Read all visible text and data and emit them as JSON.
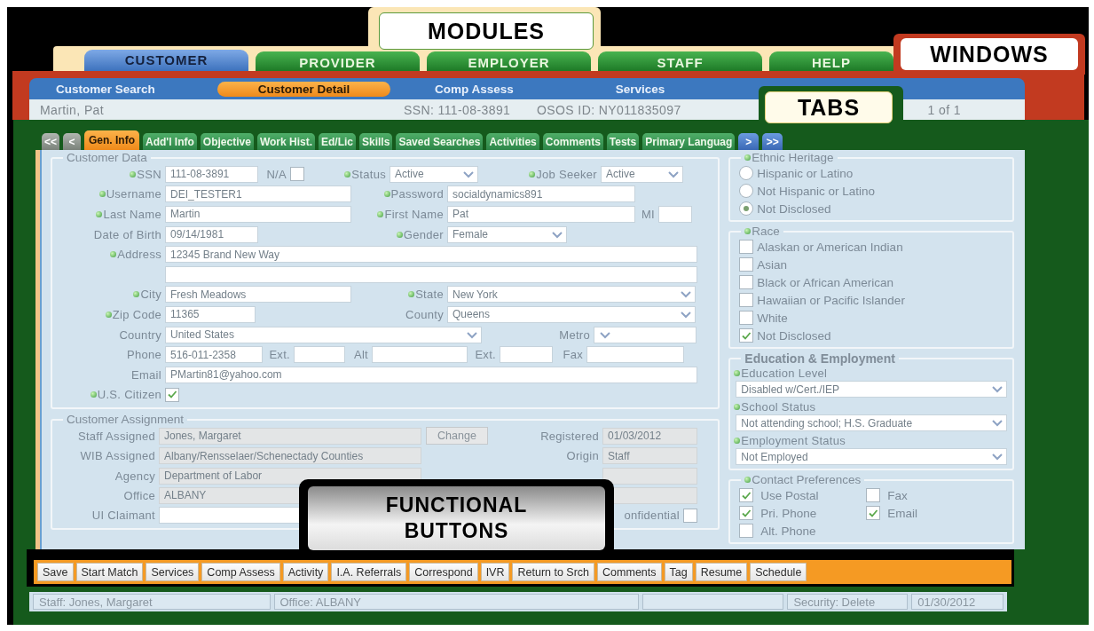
{
  "callouts": [
    "MODULES",
    "WINDOWS",
    "TABS",
    "FUNCTIONAL BUTTONS"
  ],
  "modules": [
    {
      "label": "CUSTOMER",
      "selected": true
    },
    {
      "label": "PROVIDER",
      "selected": false
    },
    {
      "label": "EMPLOYER",
      "selected": false
    },
    {
      "label": "STAFF",
      "selected": false
    },
    {
      "label": "HELP",
      "selected": false
    }
  ],
  "window": {
    "nav": [
      {
        "label": "Customer Search",
        "selected": false
      },
      {
        "label": "Customer Detail",
        "selected": true
      },
      {
        "label": "Comp Assess",
        "selected": false
      },
      {
        "label": "Services",
        "selected": false
      }
    ],
    "customer_name": "Martin, Pat",
    "ssn": "SSN: 111-08-3891",
    "osos_id": "OSOS ID: NY011835097",
    "record_count": "1 of 1"
  },
  "tab_scroll": [
    "<<",
    "<",
    ">",
    ">>"
  ],
  "tabs": [
    {
      "label": "Gen. Info",
      "selected": true
    },
    {
      "label": "Add'l Info",
      "selected": false
    },
    {
      "label": "Objective",
      "selected": false
    },
    {
      "label": "Work Hist.",
      "selected": false
    },
    {
      "label": "Ed/Lic",
      "selected": false
    },
    {
      "label": "Skills",
      "selected": false
    },
    {
      "label": "Saved Searches",
      "selected": false
    },
    {
      "label": "Activities",
      "selected": false
    },
    {
      "label": "Comments",
      "selected": false
    },
    {
      "label": "Tests",
      "selected": false
    },
    {
      "label": "Primary Languag",
      "selected": false
    }
  ],
  "customer_data": {
    "title": "Customer Data",
    "rows": [
      {
        "fields": [
          {
            "label": "SSN",
            "required": true,
            "kind": "text",
            "value": "111-08-3891"
          },
          {
            "label": "N/A",
            "kind": "checkbox",
            "checked": false
          },
          {
            "label": "Status",
            "required": true,
            "kind": "select",
            "value": "Active"
          },
          {
            "label": "Job Seeker",
            "required": true,
            "kind": "select",
            "value": "Active"
          }
        ]
      },
      {
        "fields": [
          {
            "label": "Username",
            "required": true,
            "kind": "text",
            "value": "DEI_TESTER1"
          },
          {
            "label": "Password",
            "required": true,
            "kind": "text",
            "value": "socialdynamics891"
          }
        ]
      },
      {
        "fields": [
          {
            "label": "Last Name",
            "required": true,
            "kind": "text",
            "value": "Martin"
          },
          {
            "label": "First Name",
            "required": true,
            "kind": "text",
            "value": "Pat"
          },
          {
            "label": "MI",
            "kind": "text"
          }
        ]
      },
      {
        "fields": [
          {
            "label": "Date of Birth",
            "kind": "text",
            "value": "09/14/1981"
          },
          {
            "label": "Gender",
            "required": true,
            "kind": "select",
            "value": "Female"
          }
        ]
      },
      {
        "fields": [
          {
            "label": "Address",
            "required": true,
            "kind": "text",
            "value": "12345 Brand New Way"
          }
        ]
      },
      {
        "fields": [
          {
            "kind": "text"
          }
        ]
      },
      {
        "fields": [
          {
            "label": "City",
            "required": true,
            "kind": "text",
            "value": "Fresh Meadows"
          },
          {
            "label": "State",
            "required": true,
            "kind": "select",
            "value": "New York"
          }
        ]
      },
      {
        "fields": [
          {
            "label": "Zip Code",
            "required": true,
            "kind": "text",
            "value": "11365"
          },
          {
            "label": "County",
            "kind": "select",
            "value": "Queens"
          }
        ]
      },
      {
        "fields": [
          {
            "label": "Country",
            "kind": "select",
            "value": "United States"
          },
          {
            "label": "Metro",
            "kind": "select"
          }
        ]
      },
      {
        "fields": [
          {
            "label": "Phone",
            "kind": "text",
            "value": "516-011-2358"
          },
          {
            "label": "Ext.",
            "kind": "text"
          },
          {
            "label": "Alt",
            "kind": "text"
          },
          {
            "label": "Ext.",
            "kind": "text"
          },
          {
            "label": "Fax",
            "kind": "text"
          }
        ]
      },
      {
        "fields": [
          {
            "label": "Email",
            "kind": "text",
            "value": "PMartin81@yahoo.com"
          }
        ]
      },
      {
        "fields": [
          {
            "label": "U.S. Citizen",
            "required": true,
            "kind": "checkbox",
            "checked": true
          }
        ]
      }
    ]
  },
  "customer_assignment": {
    "title": "Customer Assignment",
    "rows": [
      {
        "fields": [
          {
            "label": "Staff Assigned",
            "kind": "text",
            "value": "Jones, Margaret",
            "disabled": true
          },
          {
            "label": "Change",
            "kind": "button"
          },
          {
            "label": "Registered",
            "kind": "text",
            "value": "01/03/2012",
            "disabled": true
          }
        ]
      },
      {
        "fields": [
          {
            "label": "WIB Assigned",
            "kind": "text",
            "value": "Albany/Rensselaer/Schenectady Counties",
            "disabled": true
          },
          {
            "label": "Origin",
            "kind": "text",
            "value": "Staff",
            "disabled": true
          }
        ]
      },
      {
        "fields": [
          {
            "label": "Agency",
            "kind": "text",
            "value": "Department of Labor",
            "disabled": true
          },
          {
            "kind": "text",
            "disabled": true
          }
        ]
      },
      {
        "fields": [
          {
            "label": "Office",
            "kind": "text",
            "value": "ALBANY",
            "disabled": true
          },
          {
            "kind": "text",
            "disabled": true
          }
        ]
      },
      {
        "fields": [
          {
            "label": "UI Claimant",
            "kind": "text",
            "disabled": false
          },
          {
            "label": "onfidential",
            "kind": "checkbox",
            "checked": false
          }
        ]
      }
    ]
  },
  "ethnic_heritage": {
    "title": "Ethnic Heritage",
    "required": true,
    "options": [
      {
        "label": "Hispanic or Latino",
        "selected": false
      },
      {
        "label": "Not Hispanic or Latino",
        "selected": false
      },
      {
        "label": "Not Disclosed",
        "selected": true
      }
    ]
  },
  "race": {
    "title": "Race",
    "required": true,
    "options": [
      {
        "label": "Alaskan or American Indian",
        "checked": false
      },
      {
        "label": "Asian",
        "checked": false
      },
      {
        "label": "Black or African American",
        "checked": false
      },
      {
        "label": "Hawaiian or Pacific Islander",
        "checked": false
      },
      {
        "label": "White",
        "checked": false
      },
      {
        "label": "Not Disclosed",
        "checked": true
      }
    ]
  },
  "education_employment": {
    "title": "Education & Employment",
    "fields": [
      {
        "label": "Education Level",
        "required": true,
        "value": "Disabled w/Cert./IEP"
      },
      {
        "label": "School Status",
        "required": true,
        "value": "Not attending school; H.S. Graduate"
      },
      {
        "label": "Employment Status",
        "required": true,
        "value": "Not Employed"
      }
    ]
  },
  "contact_preferences": {
    "title": "Contact Preferences",
    "required": true,
    "options": [
      {
        "label": "Use Postal",
        "checked": true
      },
      {
        "label": "Fax",
        "checked": false
      },
      {
        "label": "Pri. Phone",
        "checked": true
      },
      {
        "label": "Email",
        "checked": true
      },
      {
        "label": "Alt. Phone",
        "checked": false
      }
    ]
  },
  "buttons": [
    "Save",
    "Start Match",
    "Services",
    "Comp Assess",
    "Activity",
    "I.A. Referrals",
    "Correspond",
    "IVR",
    "Return to Srch",
    "Comments",
    "Tag",
    "Resume",
    "Schedule"
  ],
  "status_bar": [
    "Staff: Jones, Margaret",
    "Office: ALBANY",
    "Security: Delete",
    "01/30/2012"
  ]
}
